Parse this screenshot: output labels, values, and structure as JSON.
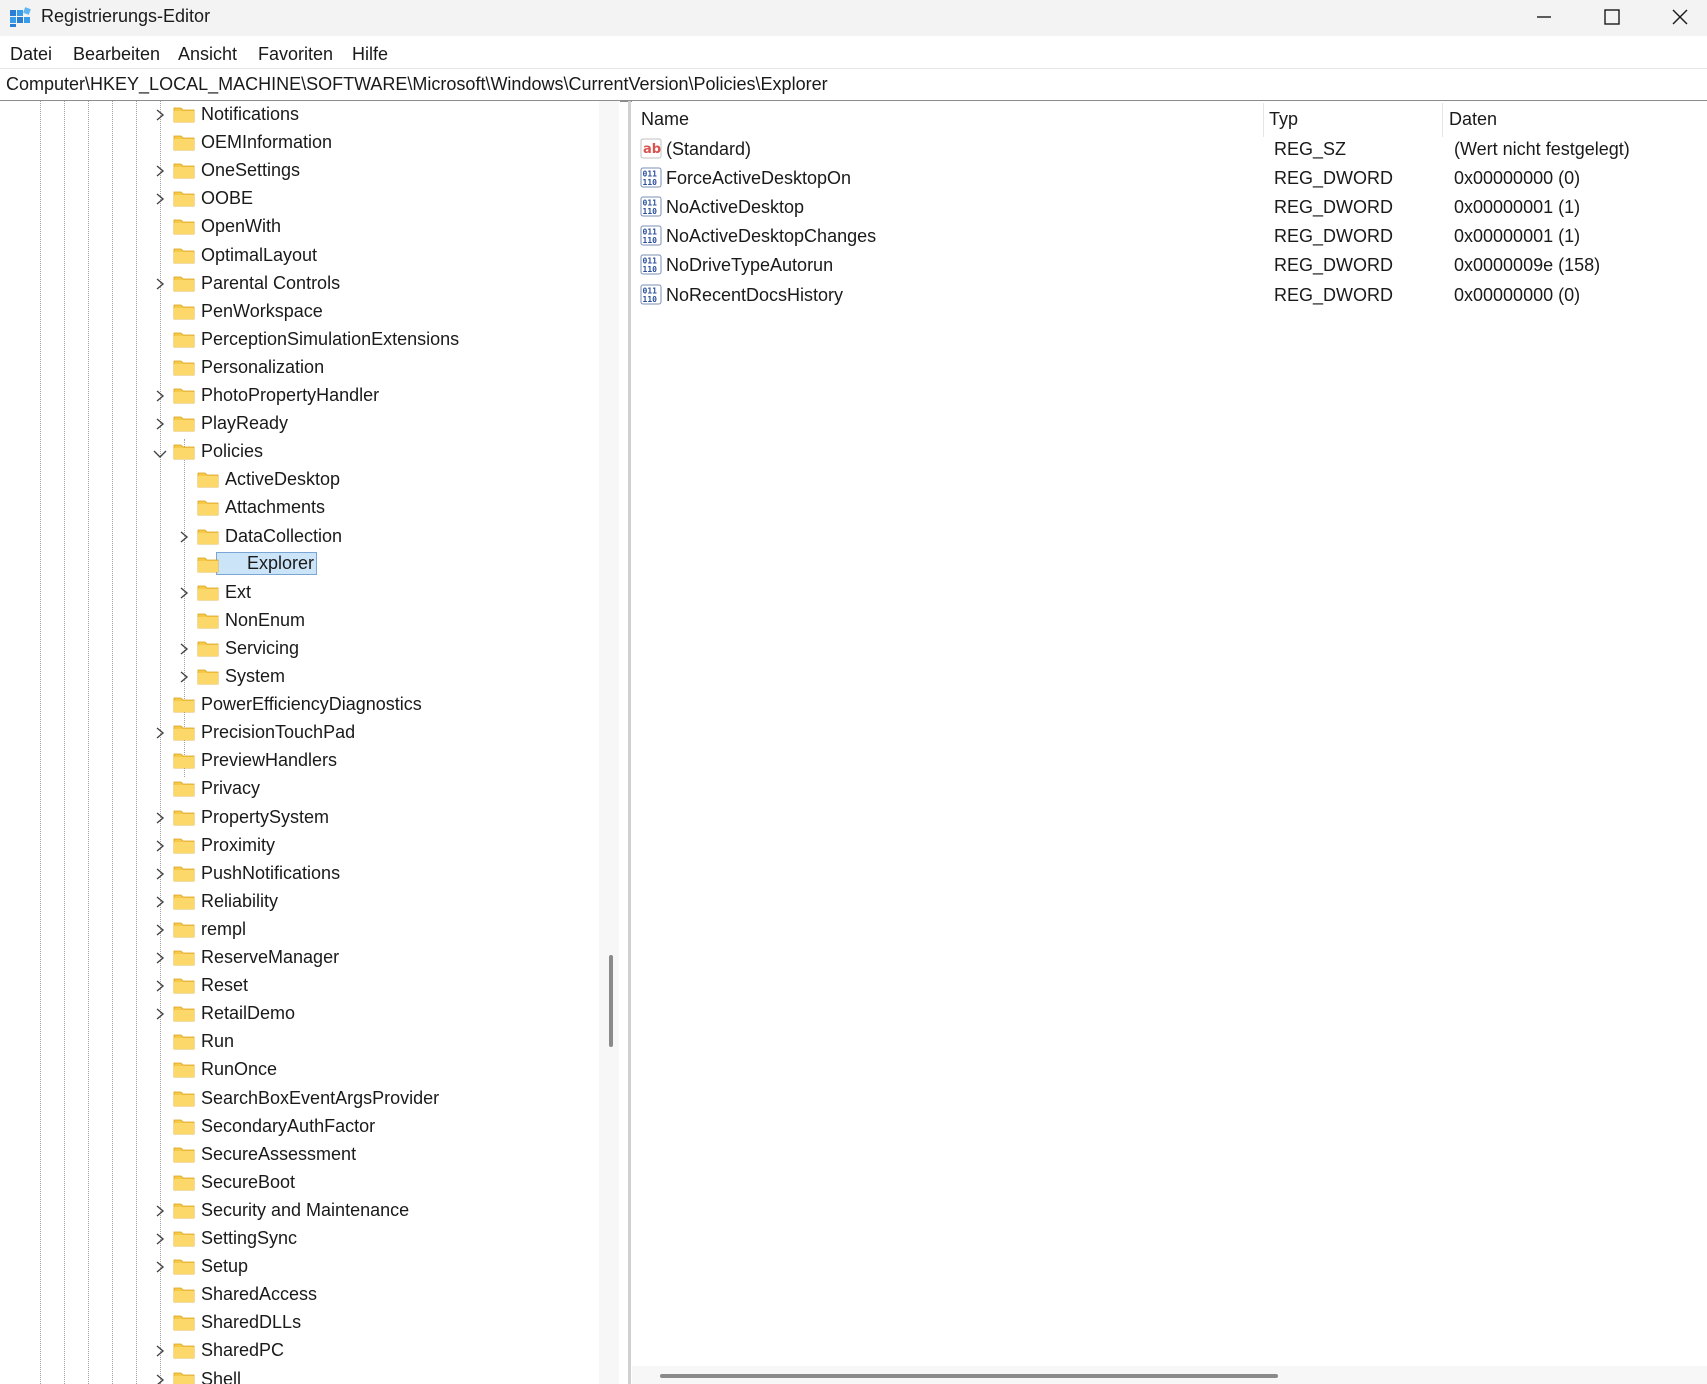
{
  "window": {
    "title": "Registrierungs-Editor",
    "icon": "regedit-icon",
    "controls": [
      "minimize-icon",
      "maximize-icon",
      "close-icon"
    ]
  },
  "menu": [
    "Datei",
    "Bearbeiten",
    "Ansicht",
    "Favoriten",
    "Hilfe"
  ],
  "address": "Computer\\HKEY_LOCAL_MACHINE\\SOFTWARE\\Microsoft\\Windows\\CurrentVersion\\Policies\\Explorer",
  "tree": [
    {
      "label": "Notifications",
      "level": 0,
      "expander": "collapsed"
    },
    {
      "label": "OEMInformation",
      "level": 0,
      "expander": "none"
    },
    {
      "label": "OneSettings",
      "level": 0,
      "expander": "collapsed"
    },
    {
      "label": "OOBE",
      "level": 0,
      "expander": "collapsed"
    },
    {
      "label": "OpenWith",
      "level": 0,
      "expander": "none"
    },
    {
      "label": "OptimalLayout",
      "level": 0,
      "expander": "none"
    },
    {
      "label": "Parental Controls",
      "level": 0,
      "expander": "collapsed"
    },
    {
      "label": "PenWorkspace",
      "level": 0,
      "expander": "none"
    },
    {
      "label": "PerceptionSimulationExtensions",
      "level": 0,
      "expander": "none"
    },
    {
      "label": "Personalization",
      "level": 0,
      "expander": "none"
    },
    {
      "label": "PhotoPropertyHandler",
      "level": 0,
      "expander": "collapsed"
    },
    {
      "label": "PlayReady",
      "level": 0,
      "expander": "collapsed"
    },
    {
      "label": "Policies",
      "level": 0,
      "expander": "expanded"
    },
    {
      "label": "ActiveDesktop",
      "level": 1,
      "expander": "none"
    },
    {
      "label": "Attachments",
      "level": 1,
      "expander": "none"
    },
    {
      "label": "DataCollection",
      "level": 1,
      "expander": "collapsed"
    },
    {
      "label": "Explorer",
      "level": 1,
      "expander": "none",
      "selected": true
    },
    {
      "label": "Ext",
      "level": 1,
      "expander": "collapsed"
    },
    {
      "label": "NonEnum",
      "level": 1,
      "expander": "none"
    },
    {
      "label": "Servicing",
      "level": 1,
      "expander": "collapsed"
    },
    {
      "label": "System",
      "level": 1,
      "expander": "collapsed"
    },
    {
      "label": "PowerEfficiencyDiagnostics",
      "level": 0,
      "expander": "none"
    },
    {
      "label": "PrecisionTouchPad",
      "level": 0,
      "expander": "collapsed"
    },
    {
      "label": "PreviewHandlers",
      "level": 0,
      "expander": "none"
    },
    {
      "label": "Privacy",
      "level": 0,
      "expander": "none"
    },
    {
      "label": "PropertySystem",
      "level": 0,
      "expander": "collapsed"
    },
    {
      "label": "Proximity",
      "level": 0,
      "expander": "collapsed"
    },
    {
      "label": "PushNotifications",
      "level": 0,
      "expander": "collapsed"
    },
    {
      "label": "Reliability",
      "level": 0,
      "expander": "collapsed"
    },
    {
      "label": "rempl",
      "level": 0,
      "expander": "collapsed"
    },
    {
      "label": "ReserveManager",
      "level": 0,
      "expander": "collapsed"
    },
    {
      "label": "Reset",
      "level": 0,
      "expander": "collapsed"
    },
    {
      "label": "RetailDemo",
      "level": 0,
      "expander": "collapsed"
    },
    {
      "label": "Run",
      "level": 0,
      "expander": "none"
    },
    {
      "label": "RunOnce",
      "level": 0,
      "expander": "none"
    },
    {
      "label": "SearchBoxEventArgsProvider",
      "level": 0,
      "expander": "none"
    },
    {
      "label": "SecondaryAuthFactor",
      "level": 0,
      "expander": "none"
    },
    {
      "label": "SecureAssessment",
      "level": 0,
      "expander": "none"
    },
    {
      "label": "SecureBoot",
      "level": 0,
      "expander": "none"
    },
    {
      "label": "Security and Maintenance",
      "level": 0,
      "expander": "collapsed"
    },
    {
      "label": "SettingSync",
      "level": 0,
      "expander": "collapsed"
    },
    {
      "label": "Setup",
      "level": 0,
      "expander": "collapsed"
    },
    {
      "label": "SharedAccess",
      "level": 0,
      "expander": "none"
    },
    {
      "label": "SharedDLLs",
      "level": 0,
      "expander": "none"
    },
    {
      "label": "SharedPC",
      "level": 0,
      "expander": "collapsed"
    },
    {
      "label": "Shell",
      "level": 0,
      "expander": "collapsed"
    }
  ],
  "list": {
    "columns": [
      "Name",
      "Typ",
      "Daten"
    ],
    "rows": [
      {
        "icon": "string-value-icon",
        "name": "(Standard)",
        "type": "REG_SZ",
        "data": "(Wert nicht festgelegt)"
      },
      {
        "icon": "binary-value-icon",
        "name": "ForceActiveDesktopOn",
        "type": "REG_DWORD",
        "data": "0x00000000 (0)"
      },
      {
        "icon": "binary-value-icon",
        "name": "NoActiveDesktop",
        "type": "REG_DWORD",
        "data": "0x00000001 (1)"
      },
      {
        "icon": "binary-value-icon",
        "name": "NoActiveDesktopChanges",
        "type": "REG_DWORD",
        "data": "0x00000001 (1)"
      },
      {
        "icon": "binary-value-icon",
        "name": "NoDriveTypeAutorun",
        "type": "REG_DWORD",
        "data": "0x0000009e (158)"
      },
      {
        "icon": "binary-value-icon",
        "name": "NoRecentDocsHistory",
        "type": "REG_DWORD",
        "data": "0x00000000 (0)"
      }
    ]
  },
  "colors": {
    "folder": "#f7c948",
    "selection": "#cce4f7",
    "titlebar": "#f3f3f3"
  }
}
